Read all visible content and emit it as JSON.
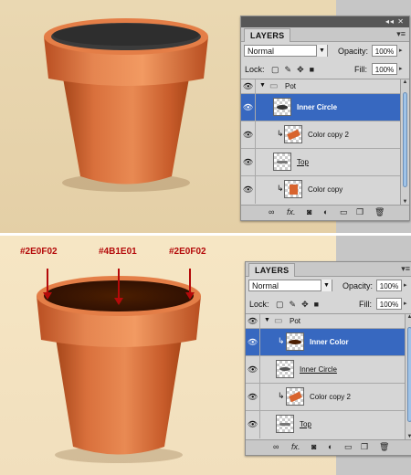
{
  "colors": {
    "pot_terracotta": "#d86a3a",
    "inner_dark_top": "#2e2e2e",
    "inner_edge": "#2E0F02",
    "inner_center": "#4B1E01",
    "selection_blue": "#3768c0",
    "annotation_red": "#b40a0a"
  },
  "annotations": {
    "left": "#2E0F02",
    "center": "#4B1E01",
    "right": "#2E0F02"
  },
  "panel_top": {
    "tab_label": "LAYERS",
    "blend_mode": "Normal",
    "opacity_label": "Opacity:",
    "opacity_value": "100%",
    "lock_label": "Lock:",
    "fill_label": "Fill:",
    "fill_value": "100%",
    "group_name": "Pot",
    "layers": [
      {
        "name": "Inner Circle",
        "selected": true,
        "clip": false,
        "icon": "dark-circle-thumb"
      },
      {
        "name": "Color copy 2",
        "selected": false,
        "clip": true,
        "icon": "orange-swatch-thumb"
      },
      {
        "name": "Top",
        "selected": false,
        "clip": false,
        "icon": "top-rim-thumb"
      },
      {
        "name": "Color copy",
        "selected": false,
        "clip": true,
        "icon": "orange-swatch-thumb"
      }
    ]
  },
  "panel_bottom": {
    "tab_label": "LAYERS",
    "blend_mode": "Normal",
    "opacity_label": "Opacity:",
    "opacity_value": "100%",
    "lock_label": "Lock:",
    "fill_label": "Fill:",
    "fill_value": "100%",
    "group_name": "Pot",
    "layers": [
      {
        "name": "Inner Color",
        "selected": true,
        "clip": true,
        "icon": "brown-ellipse-thumb"
      },
      {
        "name": "Inner Circle",
        "selected": false,
        "clip": false,
        "icon": "dark-circle-thumb"
      },
      {
        "name": "Color copy 2",
        "selected": false,
        "clip": true,
        "icon": "orange-swatch-thumb"
      },
      {
        "name": "Top",
        "selected": false,
        "clip": false,
        "icon": "top-rim-thumb"
      }
    ]
  }
}
